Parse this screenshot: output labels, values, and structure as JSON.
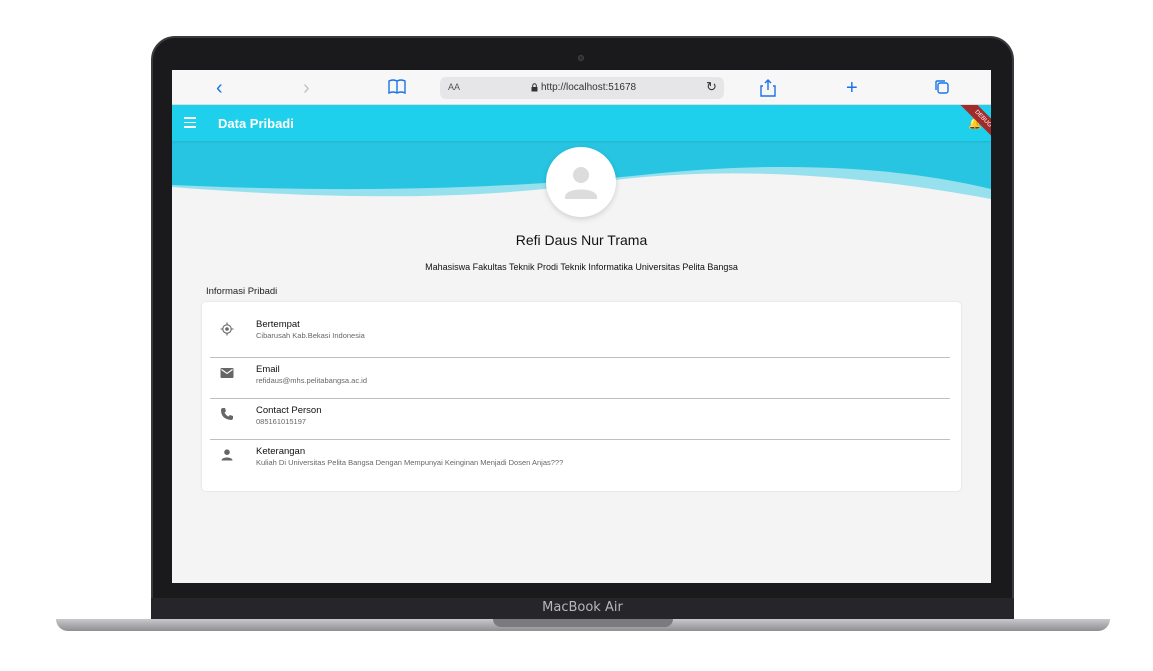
{
  "device": {
    "label": "MacBook Air"
  },
  "browser": {
    "text_size_label": "AA",
    "url": "http://localhost:51678",
    "icons": [
      "back-icon",
      "forward-icon",
      "bookmarks-icon",
      "reload-icon",
      "share-icon",
      "new-tab-icon",
      "tabs-icon"
    ]
  },
  "app": {
    "title": "Data Pribadi",
    "debug_badge": "DEBUG",
    "accent": "#1fd0ec"
  },
  "profile": {
    "name": "Refi Daus Nur Trama",
    "subtitle": "Mahasiswa Fakultas Teknik Prodi Teknik Informatika Universitas Pelita Bangsa"
  },
  "section": {
    "label": "Informasi Pribadi"
  },
  "info": [
    {
      "icon": "location-icon",
      "label": "Bertempat",
      "value": "Cibarusah Kab.Bekasi Indonesia"
    },
    {
      "icon": "email-icon",
      "label": "Email",
      "value": "refidaus@mhs.pelitabangsa.ac.id"
    },
    {
      "icon": "phone-icon",
      "label": "Contact Person",
      "value": "085161015197"
    },
    {
      "icon": "person-icon",
      "label": "Keterangan",
      "value": "Kuliah Di Universitas Pelita Bangsa Dengan Mempunyai Keinginan Menjadi Dosen Anjas???"
    }
  ]
}
